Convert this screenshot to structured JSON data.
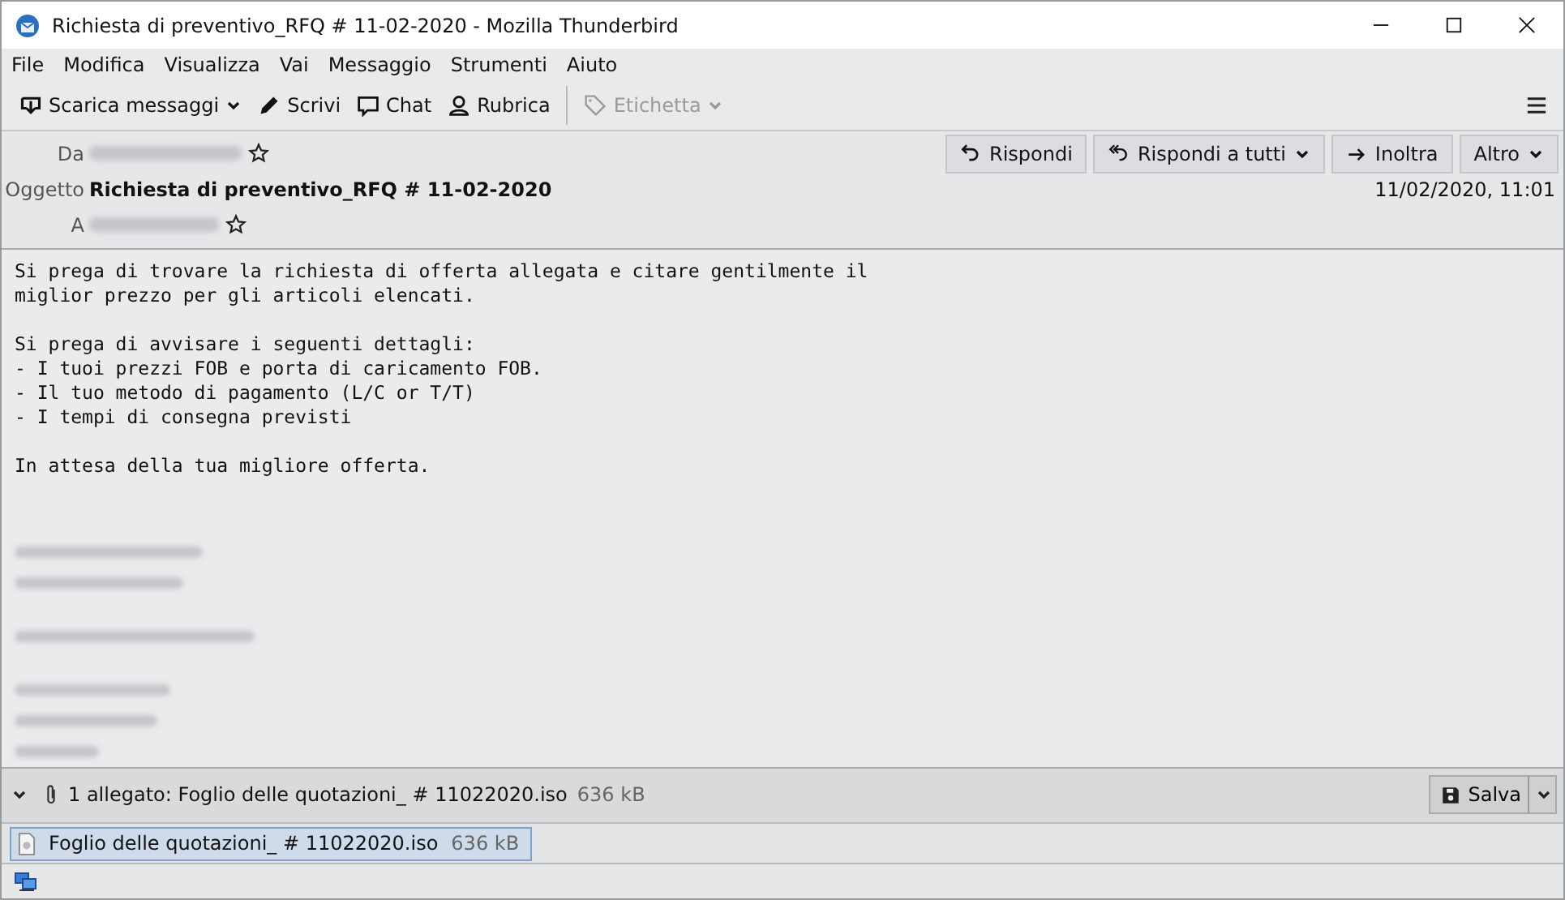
{
  "window": {
    "title": "Richiesta di preventivo_RFQ # 11-02-2020 - Mozilla Thunderbird"
  },
  "menu": [
    "File",
    "Modifica",
    "Visualizza",
    "Vai",
    "Messaggio",
    "Strumenti",
    "Aiuto"
  ],
  "toolbar": [
    {
      "kind": "download",
      "label": "Scarica messaggi",
      "disabled": false,
      "dropdown": true
    },
    {
      "kind": "pencil",
      "label": "Scrivi",
      "disabled": false,
      "dropdown": false
    },
    {
      "kind": "chat",
      "label": "Chat",
      "disabled": false,
      "dropdown": false
    },
    {
      "kind": "contacts",
      "label": "Rubrica",
      "disabled": false,
      "dropdown": false
    },
    {
      "kind": "tag",
      "label": "Etichetta",
      "disabled": true,
      "dropdown": true
    }
  ],
  "header": {
    "from_label": "Da",
    "subject_label": "Oggetto",
    "subject": "Richiesta di preventivo_RFQ # 11-02-2020",
    "to_label": "A",
    "date": "11/02/2020, 11:01",
    "actions": [
      {
        "kind": "reply",
        "label": "Rispondi",
        "dropdown": false
      },
      {
        "kind": "reply-all",
        "label": "Rispondi a tutti",
        "dropdown": true
      },
      {
        "kind": "forward",
        "label": "Inoltra",
        "dropdown": false
      },
      {
        "kind": "more",
        "label": "Altro",
        "dropdown": true
      }
    ]
  },
  "body": [
    [
      "Si prega di trovare la richiesta di offerta allegata e citare gentilmente il",
      "miglior prezzo per gli articoli elencati."
    ],
    [
      "Si prega di avvisare i seguenti dettagli:",
      "- I tuoi prezzi FOB e porta di caricamento FOB.",
      "- Il tuo metodo di pagamento (L/C or T/T)",
      "- I tempi di consegna previsti"
    ],
    [
      "In attesa della tua migliore offerta."
    ]
  ],
  "attachment_bar": {
    "expanded": true,
    "summary": "1 allegato: Foglio delle quotazioni_ # 11022020.iso",
    "size": "636 kB",
    "save": "Salva"
  },
  "attachments": [
    {
      "name": "Foglio delle quotazioni_ # 11022020.iso",
      "size": "636 kB",
      "selected": true
    }
  ]
}
